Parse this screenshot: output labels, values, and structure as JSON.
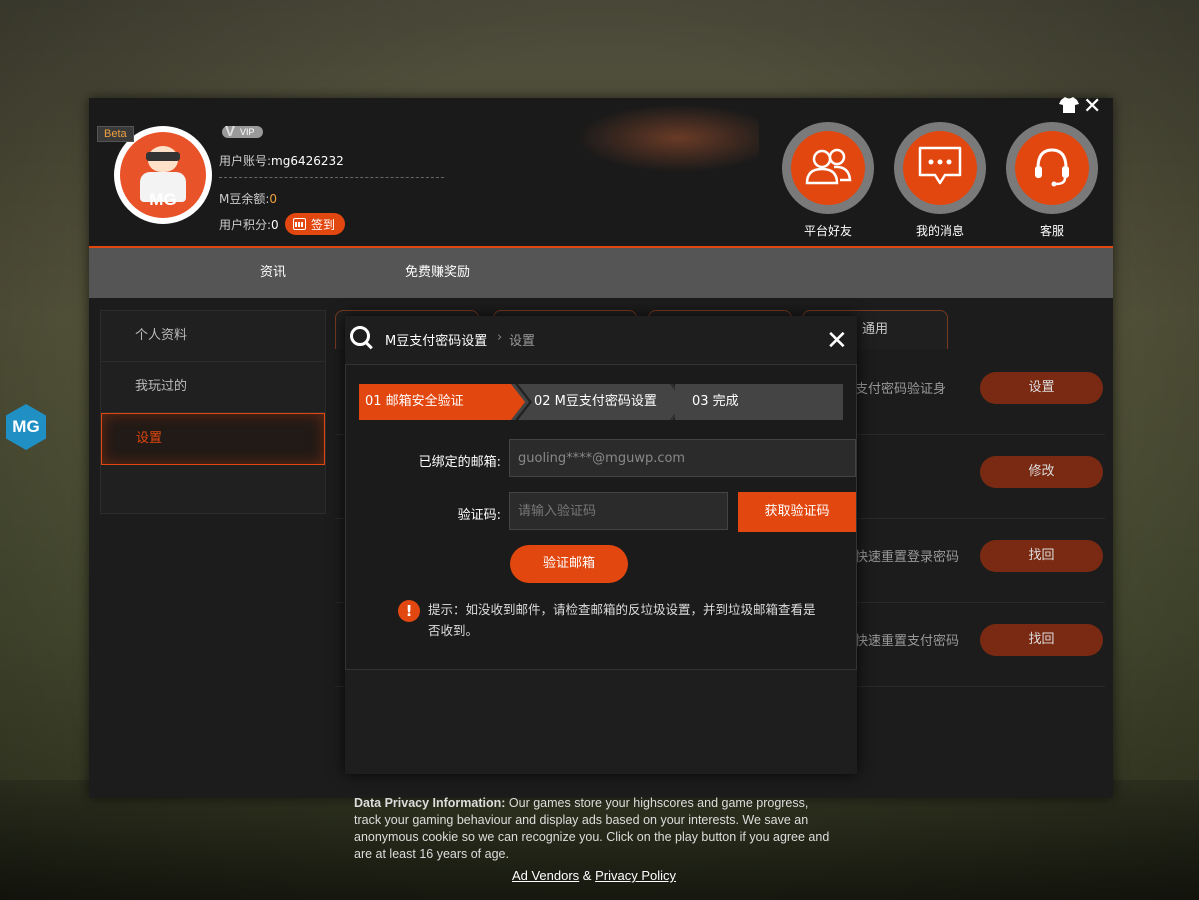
{
  "header": {
    "beta_label": "Beta",
    "vip_label": "VIP",
    "avatar_text": "MG",
    "account_label": "用户账号:",
    "account_value": "mg6426232",
    "balance_label": "M豆余额:",
    "balance_value": "0",
    "points_label": "用户积分:",
    "points_value": "0",
    "checkin_label": "签到",
    "buttons": [
      {
        "label": "平台好友",
        "icon": "friends-icon"
      },
      {
        "label": "我的消息",
        "icon": "message-icon"
      },
      {
        "label": "客服",
        "icon": "headset-icon"
      }
    ]
  },
  "nav": {
    "items": [
      {
        "label": "资讯"
      },
      {
        "label": "免费赚奖励"
      }
    ]
  },
  "sidebar": {
    "items": [
      {
        "label": "个人资料"
      },
      {
        "label": "我玩过的"
      },
      {
        "label": "设置"
      }
    ],
    "active": "设置"
  },
  "content": {
    "tabs": [
      {
        "label": ""
      },
      {
        "label": ""
      },
      {
        "label": ""
      },
      {
        "label": "通用"
      }
    ],
    "rows": [
      {
        "desc": "支付密码验证身",
        "action": "设置"
      },
      {
        "desc": "",
        "action": "修改"
      },
      {
        "desc": "快速重置登录密码",
        "action": "找回"
      },
      {
        "desc": "快速重置支付密码",
        "action": "找回"
      }
    ]
  },
  "modal": {
    "title": "M豆支付密码设置",
    "crumb_sep": "›",
    "crumb_sub": "设置",
    "close": "✕",
    "steps": [
      {
        "label": "01 邮箱安全验证"
      },
      {
        "label": "02 M豆支付密码设置"
      },
      {
        "label": "03 完成"
      }
    ],
    "email_label": "已绑定的邮箱:",
    "email_value": "guoling****@mguwp.com",
    "code_label": "验证码:",
    "code_placeholder": "请输入验证码",
    "get_code_label": "获取验证码",
    "verify_label": "验证邮箱",
    "tip_icon": "!",
    "tip_text": "提示：如没收到邮件，请检查邮箱的反垃圾设置，并到垃圾邮箱查看是否收到。"
  },
  "privacy": {
    "heading": "Data Privacy Information:",
    "body": " Our games store your highscores and game progress, track your gaming behaviour and display ads based on your interests. We save an anonymous cookie so we can recognize you. Click on the play button if you agree and are at least 16 years of age.",
    "link1": "Ad Vendors",
    "amp": " & ",
    "link2": "Privacy Policy"
  },
  "side_logo": "MG",
  "colors": {
    "accent": "#e2470f",
    "panel": "#1c1c1c",
    "nav": "#555555"
  }
}
